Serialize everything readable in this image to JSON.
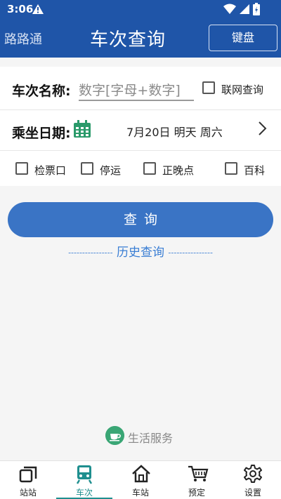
{
  "status_bar": {
    "time": "3:06"
  },
  "header": {
    "brand": "路路通",
    "title": "车次查询",
    "keyboard_button": "键盘"
  },
  "form": {
    "train_label": "车次名称:",
    "train_placeholder": "数字[字母+数字]",
    "online_query_label": "联网查询",
    "date_label": "乘坐日期:",
    "date_value": "7月20日 明天 周六",
    "options": [
      {
        "label": "检票口",
        "checked": false
      },
      {
        "label": "停运",
        "checked": false
      },
      {
        "label": "正晚点",
        "checked": false
      },
      {
        "label": "百科",
        "checked": false
      }
    ]
  },
  "query_button": "查询",
  "history_link": "历史查询",
  "life_service": "生活服务",
  "bottom_nav": {
    "items": [
      {
        "label": "站站",
        "icon": "station-to-station-icon"
      },
      {
        "label": "车次",
        "icon": "train-icon",
        "active": true
      },
      {
        "label": "车站",
        "icon": "home-station-icon"
      },
      {
        "label": "预定",
        "icon": "cart-icon"
      },
      {
        "label": "设置",
        "icon": "gear-icon"
      }
    ]
  },
  "colors": {
    "primary": "#1f55a8",
    "button": "#3a74c5",
    "accent": "#1f8f8f",
    "link": "#3a7ed4"
  }
}
